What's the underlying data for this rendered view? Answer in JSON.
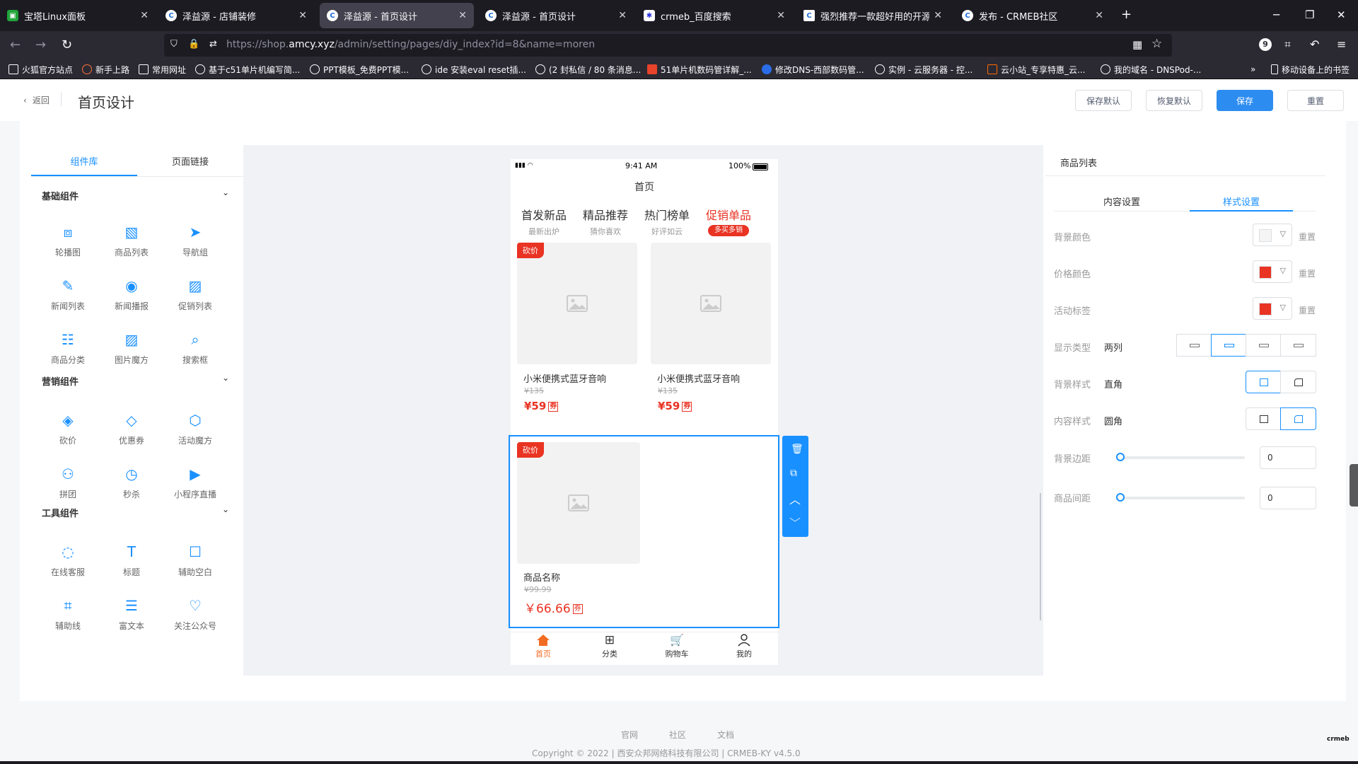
{
  "browser": {
    "tabs": [
      {
        "title": "宝塔Linux面板",
        "favicon": "bt-icon"
      },
      {
        "title": "泽益源 - 店铺装修",
        "favicon": "crmeb-icon"
      },
      {
        "title": "泽益源 - 首页设计",
        "favicon": "crmeb-icon"
      },
      {
        "title": "泽益源 - 首页设计",
        "favicon": "crmeb-icon"
      },
      {
        "title": "crmeb_百度搜索",
        "favicon": "baidu-icon"
      },
      {
        "title": "强烈推荐一款超好用的开源电商",
        "favicon": "crmeb-icon"
      },
      {
        "title": "发布 - CRMEB社区",
        "favicon": "crmeb-icon"
      }
    ],
    "url_prefix": "https://shop.",
    "url_host": "amcy.xyz",
    "url_path": "/admin/setting/pages/diy_index?id=8&name=moren",
    "extension_badge": "9",
    "bookmarks": [
      "火狐官方站点",
      "新手上路",
      "常用网址",
      "基于c51单片机编写简...",
      "PPT模板_免费PPT模...",
      "ide 安装eval reset插...",
      "(2 封私信 / 80 条消息...",
      "51单片机数码管详解_...",
      "修改DNS-西部数码管...",
      "实例 - 云服务器 - 控...",
      "云小站_专享特惠_云...",
      "我的域名 - DNSPod-..."
    ],
    "bookmarks_mobile": "移动设备上的书签"
  },
  "header": {
    "back_label": "返回",
    "title": "首页设计",
    "buttons": {
      "save_default": "保存默认",
      "restore_default": "恢复默认",
      "save": "保存",
      "reset": "重置"
    }
  },
  "left": {
    "tabs": [
      "组件库",
      "页面链接"
    ],
    "sections": [
      {
        "title": "基础组件",
        "items": [
          {
            "label": "轮播图",
            "icon": "carousel-icon"
          },
          {
            "label": "商品列表",
            "icon": "product-list-icon"
          },
          {
            "label": "导航组",
            "icon": "nav-group-icon"
          },
          {
            "label": "新闻列表",
            "icon": "news-list-icon"
          },
          {
            "label": "新闻播报",
            "icon": "news-broadcast-icon"
          },
          {
            "label": "促销列表",
            "icon": "promotion-list-icon"
          },
          {
            "label": "商品分类",
            "icon": "category-icon"
          },
          {
            "label": "图片魔方",
            "icon": "image-cube-icon"
          },
          {
            "label": "搜索框",
            "icon": "search-box-icon"
          }
        ]
      },
      {
        "title": "营销组件",
        "items": [
          {
            "label": "砍价",
            "icon": "bargain-icon"
          },
          {
            "label": "优惠券",
            "icon": "coupon-icon"
          },
          {
            "label": "活动魔方",
            "icon": "activity-cube-icon"
          },
          {
            "label": "拼团",
            "icon": "group-buy-icon"
          },
          {
            "label": "秒杀",
            "icon": "flash-sale-icon"
          },
          {
            "label": "小程序直播",
            "icon": "live-icon"
          }
        ]
      },
      {
        "title": "工具组件",
        "items": [
          {
            "label": "在线客服",
            "icon": "customer-service-icon"
          },
          {
            "label": "标题",
            "icon": "title-icon"
          },
          {
            "label": "辅助空白",
            "icon": "blank-icon"
          },
          {
            "label": "辅助线",
            "icon": "divider-icon"
          },
          {
            "label": "富文本",
            "icon": "rich-text-icon"
          },
          {
            "label": "关注公众号",
            "icon": "follow-icon"
          }
        ]
      }
    ]
  },
  "phone": {
    "status_time": "9:41 AM",
    "battery": "100%",
    "page_title": "首页",
    "tabs": [
      {
        "title": "首发新品",
        "sub": "最新出炉"
      },
      {
        "title": "精品推荐",
        "sub": "猜你喜欢"
      },
      {
        "title": "热门榜单",
        "sub": "好评如云"
      },
      {
        "title": "促销单品",
        "sub": "多买多销"
      }
    ],
    "products": [
      {
        "badge": "砍价",
        "name": "小米便携式蓝牙音响",
        "original": "¥135",
        "price": "¥59",
        "coupon": "券"
      },
      {
        "badge": "",
        "name": "小米便携式蓝牙音响",
        "original": "¥135",
        "price": "¥59",
        "coupon": "券"
      }
    ],
    "selected_product": {
      "badge": "砍价",
      "name": "商品名称",
      "original": "¥99.99",
      "price": "￥66.66",
      "coupon": "券"
    },
    "tabbar": [
      "首页",
      "分类",
      "购物车",
      "我的"
    ]
  },
  "right": {
    "title": "商品列表",
    "tabs": [
      "内容设置",
      "样式设置"
    ],
    "rows": {
      "bg_color": {
        "label": "背景颜色",
        "color": "#f5f5f5",
        "reset": "重置"
      },
      "price_color": {
        "label": "价格颜色",
        "color": "#e93323",
        "reset": "重置"
      },
      "activity_tag": {
        "label": "活动标签",
        "color": "#e93323",
        "reset": "重置"
      },
      "display_type": {
        "label": "显示类型",
        "value": "两列"
      },
      "bg_style": {
        "label": "背景样式",
        "value": "直角"
      },
      "content_style": {
        "label": "内容样式",
        "value": "圆角"
      },
      "bg_margin": {
        "label": "背景边距",
        "value": "0"
      },
      "item_gap": {
        "label": "商品间距",
        "value": "0"
      }
    }
  },
  "footer": {
    "links": [
      "官网",
      "社区",
      "文档"
    ],
    "copyright": "Copyright © 2022 | 西安众邦网络科技有限公司 | CRMEB-KY v4.5.0"
  },
  "colors": {
    "accent": "#1890ff",
    "primary_btn": "#2d8cf0",
    "price": "#e93323"
  }
}
